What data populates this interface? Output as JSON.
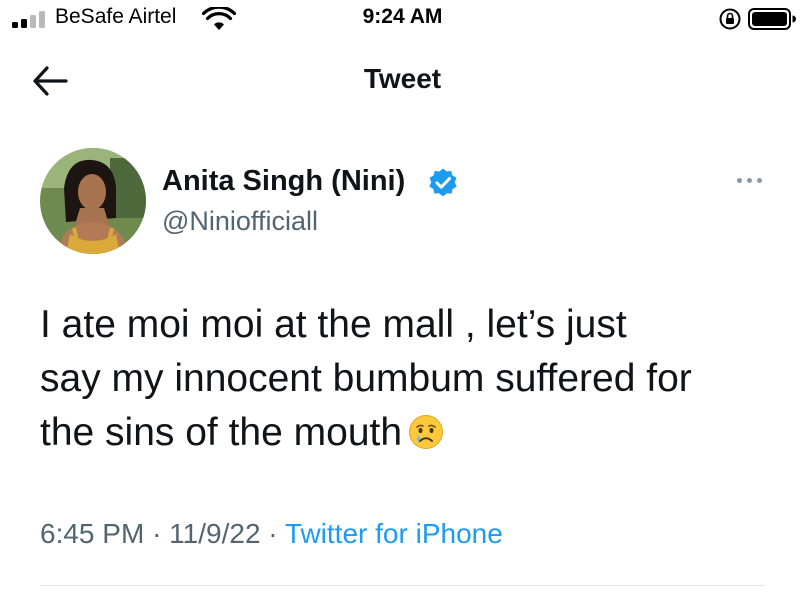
{
  "status_bar": {
    "carrier": "BeSafe Airtel",
    "time": "9:24 AM"
  },
  "nav": {
    "title": "Tweet",
    "back_icon": "arrow-left-icon"
  },
  "tweet": {
    "author": {
      "name": "Anita Singh (Nini)",
      "handle": "@Niniofficiall",
      "verified": true
    },
    "text_lines": [
      "I ate moi moi at the mall , let’s just",
      "say my innocent bumbum suffered for",
      "the sins of the mouth"
    ],
    "emoji": "crying-face-emoji",
    "time": "6:45 PM",
    "date": "11/9/22",
    "separator": "·",
    "source": "Twitter for iPhone"
  },
  "colors": {
    "text": "#0f1419",
    "secondary": "#536471",
    "accent": "#1d9bf0",
    "divider": "#e1e8ed"
  }
}
